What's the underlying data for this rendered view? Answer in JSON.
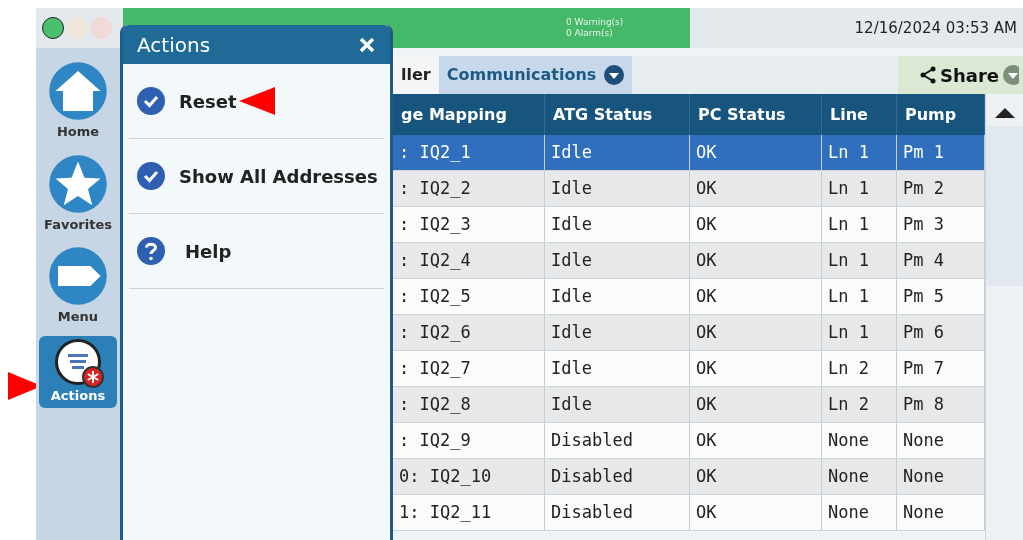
{
  "top_bar": {
    "status_lights": [
      {
        "color": "#4cbf6e"
      },
      {
        "color": "#efe6dc"
      },
      {
        "color": "#f0d9d9"
      }
    ],
    "alerts": [
      "0 Warning(s)",
      "0 Alarm(s)"
    ],
    "datetime": "12/16/2024 03:53 AM"
  },
  "sidebar": {
    "items": [
      {
        "label": "Home",
        "kind": "home",
        "selected": false
      },
      {
        "label": "Favorites",
        "kind": "star",
        "selected": false
      },
      {
        "label": "Menu",
        "kind": "menu",
        "selected": false
      },
      {
        "label": "Actions",
        "kind": "actions",
        "selected": true
      }
    ]
  },
  "actions_panel": {
    "title": "Actions",
    "items": [
      {
        "label": "Reset",
        "kind": "check"
      },
      {
        "label": "Show All Addresses",
        "kind": "check"
      },
      {
        "label": "Help",
        "kind": "help"
      }
    ]
  },
  "tabs": [
    {
      "label": "ller",
      "selected": false
    },
    {
      "label": "Communications",
      "selected": true
    }
  ],
  "share": {
    "label": "Share"
  },
  "table": {
    "columns": [
      "ge Mapping",
      "ATG Status",
      "PC Status",
      "Line",
      "Pump"
    ],
    "rows": [
      {
        "cells": [
          ": IQ2_1",
          "Idle",
          "OK",
          "Ln 1",
          "Pm 1"
        ],
        "selected": true
      },
      {
        "cells": [
          ": IQ2_2",
          "Idle",
          "OK",
          "Ln 1",
          "Pm 2"
        ],
        "selected": false
      },
      {
        "cells": [
          ": IQ2_3",
          "Idle",
          "OK",
          "Ln 1",
          "Pm 3"
        ],
        "selected": false
      },
      {
        "cells": [
          ": IQ2_4",
          "Idle",
          "OK",
          "Ln 1",
          "Pm 4"
        ],
        "selected": false
      },
      {
        "cells": [
          ": IQ2_5",
          "Idle",
          "OK",
          "Ln 1",
          "Pm 5"
        ],
        "selected": false
      },
      {
        "cells": [
          ": IQ2_6",
          "Idle",
          "OK",
          "Ln 1",
          "Pm 6"
        ],
        "selected": false
      },
      {
        "cells": [
          ": IQ2_7",
          "Idle",
          "OK",
          "Ln 2",
          "Pm 7"
        ],
        "selected": false
      },
      {
        "cells": [
          ": IQ2_8",
          "Idle",
          "OK",
          "Ln 2",
          "Pm 8"
        ],
        "selected": false
      },
      {
        "cells": [
          ": IQ2_9",
          "Disabled",
          "OK",
          "None",
          "None"
        ],
        "selected": false
      },
      {
        "cells": [
          "0: IQ2_10",
          "Disabled",
          "OK",
          "None",
          "None"
        ],
        "selected": false
      },
      {
        "cells": [
          "1: IQ2_11",
          "Disabled",
          "OK",
          "None",
          "None"
        ],
        "selected": false
      }
    ]
  }
}
